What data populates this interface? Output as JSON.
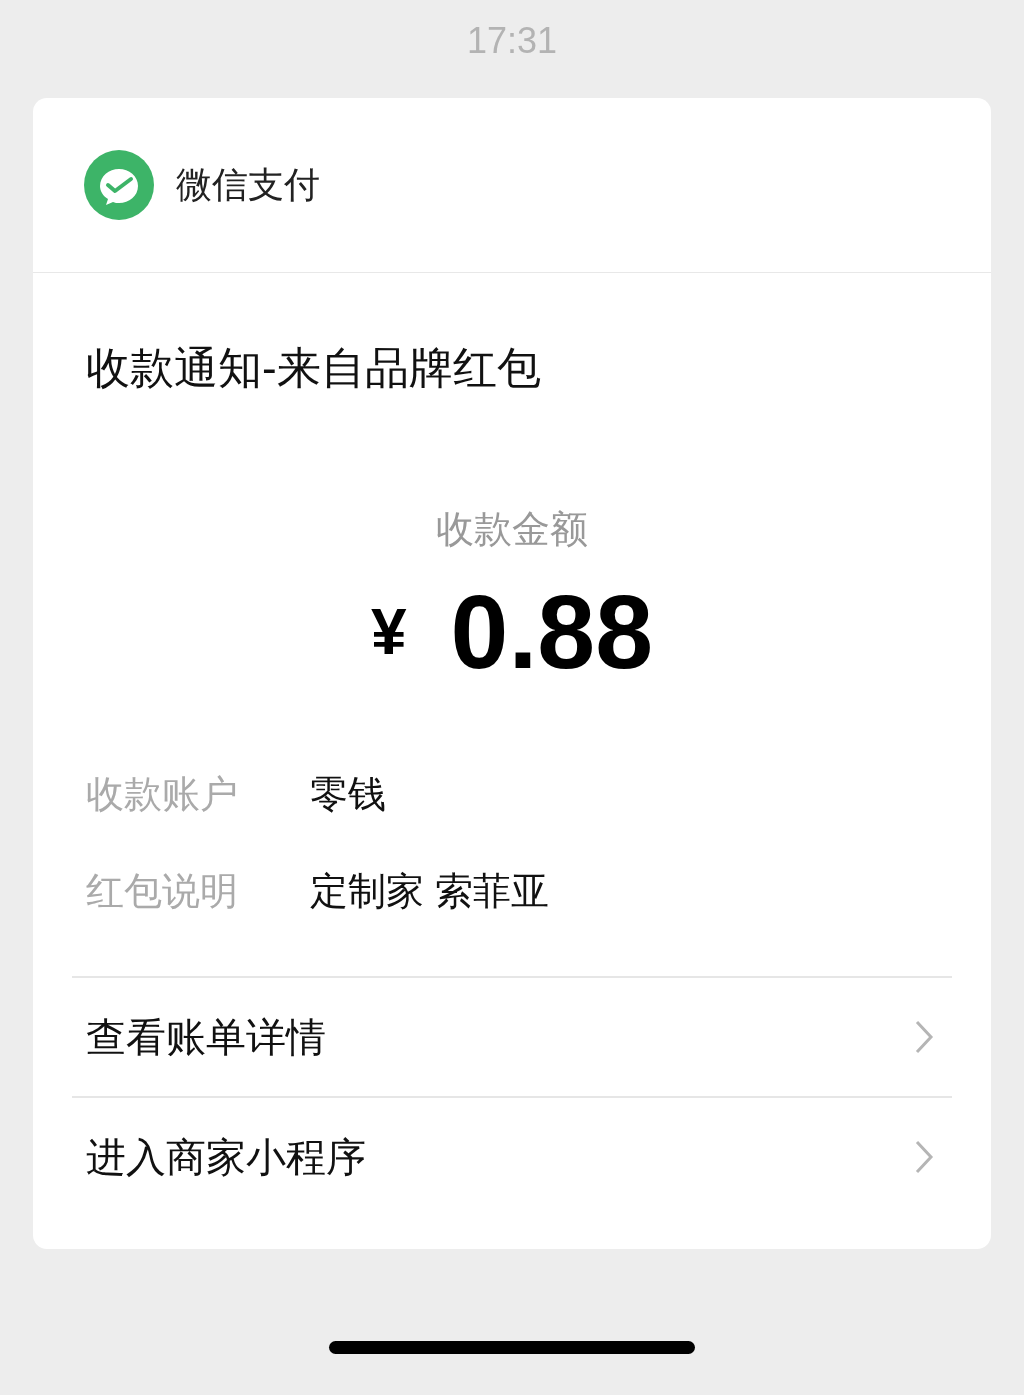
{
  "status_bar": {
    "time": "17:31"
  },
  "header": {
    "app_name": "微信支付"
  },
  "title": "收款通知-来自品牌红包",
  "amount": {
    "label": "收款金额",
    "currency": "¥",
    "value": "0.88"
  },
  "details": [
    {
      "label": "收款账户",
      "value": "零钱"
    },
    {
      "label": "红包说明",
      "value": "定制家 索菲亚"
    }
  ],
  "links": [
    {
      "label": "查看账单详情"
    },
    {
      "label": "进入商家小程序"
    }
  ]
}
